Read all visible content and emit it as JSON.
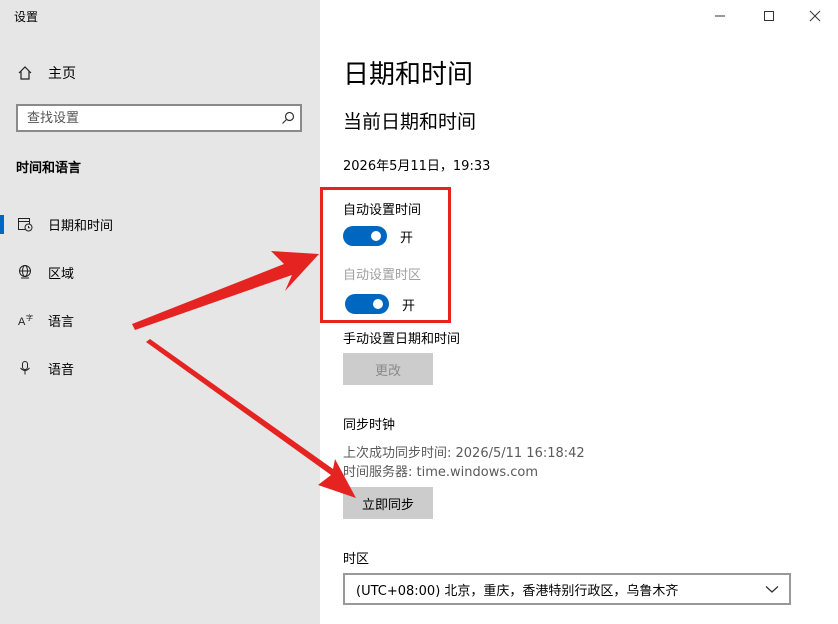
{
  "window": {
    "title": "设置",
    "controls": [
      "minimize-icon",
      "maximize-icon",
      "close-icon"
    ]
  },
  "sidebar": {
    "home_label": "主页",
    "search_placeholder": "查找设置",
    "section_title": "时间和语言",
    "items": [
      {
        "label": "日期和时间",
        "icon": "calendar-clock-icon",
        "selected": true
      },
      {
        "label": "区域",
        "icon": "globe-icon",
        "selected": false
      },
      {
        "label": "语言",
        "icon": "language-icon",
        "selected": false
      },
      {
        "label": "语音",
        "icon": "microphone-icon",
        "selected": false
      }
    ]
  },
  "main": {
    "page_title": "日期和时间",
    "section_title": "当前日期和时间",
    "current_datetime": "2026年5月11日，19:33",
    "auto_time": {
      "label": "自动设置时间",
      "state": "开",
      "on": true
    },
    "auto_timezone": {
      "label": "自动设置时区",
      "state": "开",
      "on": true
    },
    "manual": {
      "label": "手动设置日期和时间",
      "button": "更改"
    },
    "sync": {
      "label": "同步时钟",
      "last_sync": "上次成功同步时间: 2026/5/11 16:18:42",
      "server": "时间服务器: time.windows.com",
      "button": "立即同步"
    },
    "timezone": {
      "label": "时区",
      "value": "(UTC+08:00) 北京，重庆，香港特别行政区，乌鲁木齐"
    }
  },
  "colors": {
    "accent": "#0067c0",
    "annotation": "#e52421",
    "sidebar_bg": "#e6e6e6"
  }
}
